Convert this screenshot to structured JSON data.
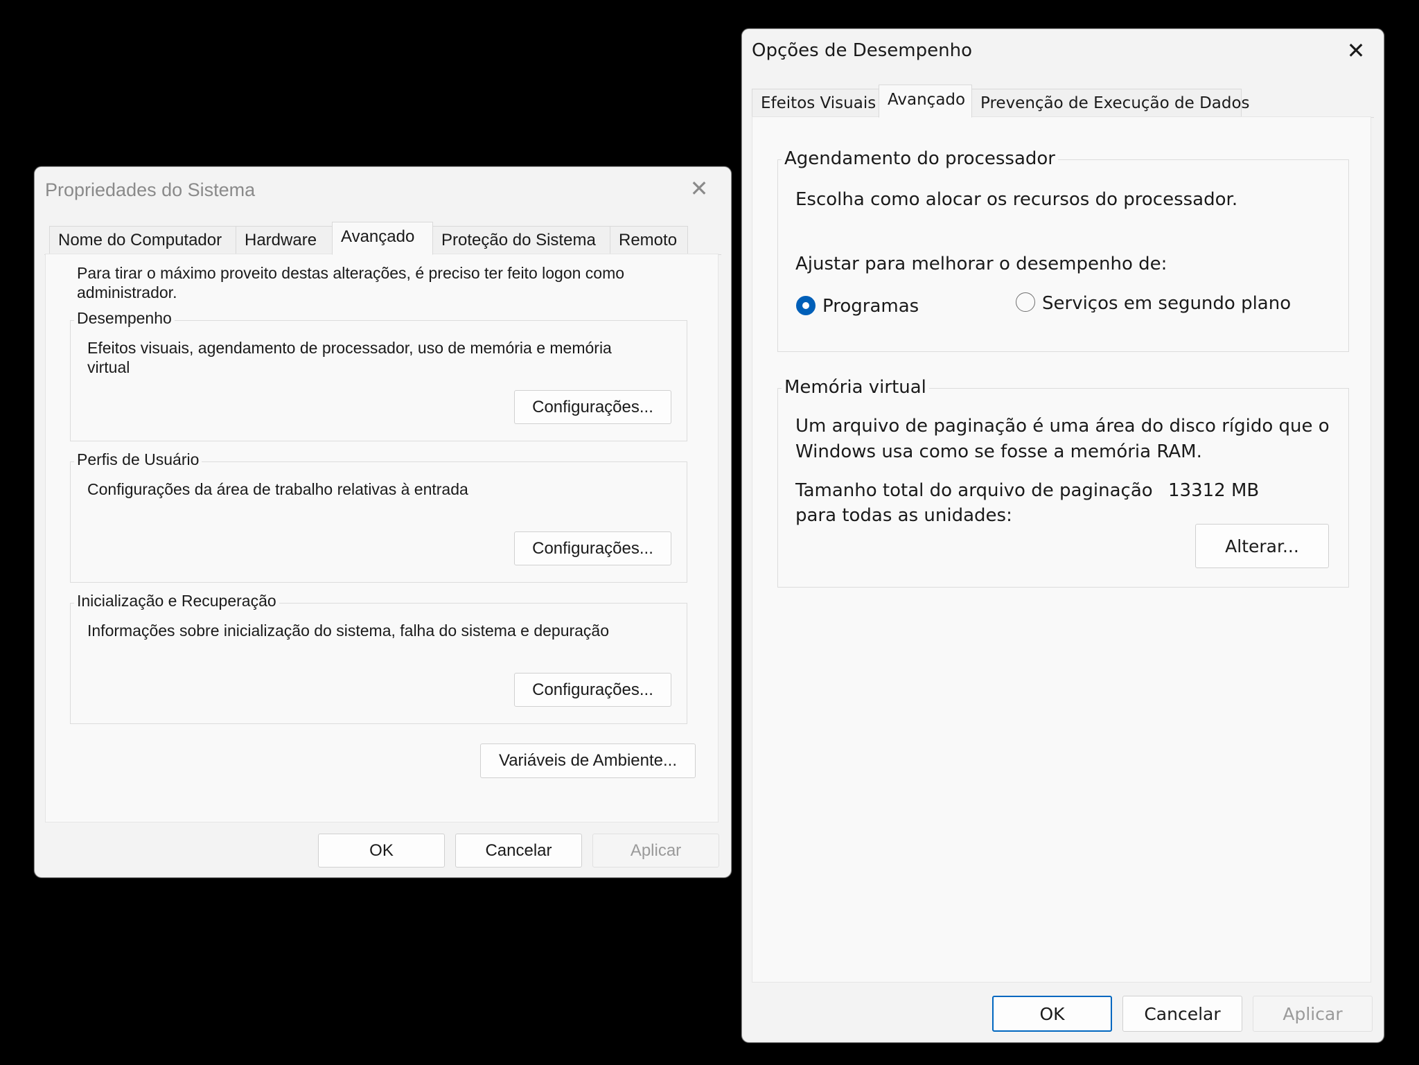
{
  "system_properties": {
    "title": "Propriedades do Sistema",
    "tabs": [
      "Nome do Computador",
      "Hardware",
      "Avançado",
      "Proteção do Sistema",
      "Remoto"
    ],
    "active_tab": "Avançado",
    "intro_line1": "Para tirar o máximo proveito destas alterações, é preciso ter feito logon como",
    "intro_line2": "administrador.",
    "performance": {
      "label": "Desempenho",
      "desc_line1": "Efeitos visuais, agendamento de processador, uso de memória e memória",
      "desc_line2": "virtual",
      "button": "Configurações..."
    },
    "user_profiles": {
      "label": "Perfis de Usuário",
      "desc": "Configurações da área de trabalho relativas à entrada",
      "button": "Configurações..."
    },
    "startup_recovery": {
      "label": "Inicialização e Recuperação",
      "desc": "Informações sobre inicialização do sistema, falha do sistema e depuração",
      "button": "Configurações..."
    },
    "env_button": "Variáveis de Ambiente...",
    "ok": "OK",
    "cancel": "Cancelar",
    "apply": "Aplicar"
  },
  "performance_options": {
    "title": "Opções de Desempenho",
    "tabs": [
      "Efeitos Visuais",
      "Avançado",
      "Prevenção de Execução de Dados"
    ],
    "active_tab": "Avançado",
    "processor_scheduling": {
      "label": "Agendamento do processador",
      "desc": "Escolha como alocar os recursos do processador.",
      "adjust_label": "Ajustar para melhorar o desempenho de:",
      "option_programs": "Programas",
      "option_services": "Serviços em segundo plano",
      "selected": "Programas"
    },
    "virtual_memory": {
      "label": "Memória virtual",
      "desc_line1": "Um arquivo de paginação é uma área do disco rígido que o",
      "desc_line2": "Windows usa como se fosse a memória RAM.",
      "total_label_line1": "Tamanho total do arquivo de paginação",
      "total_label_line2": "para todas as unidades:",
      "total_value": "13312 MB",
      "change_button": "Alterar..."
    },
    "ok": "OK",
    "cancel": "Cancelar",
    "apply": "Aplicar"
  }
}
